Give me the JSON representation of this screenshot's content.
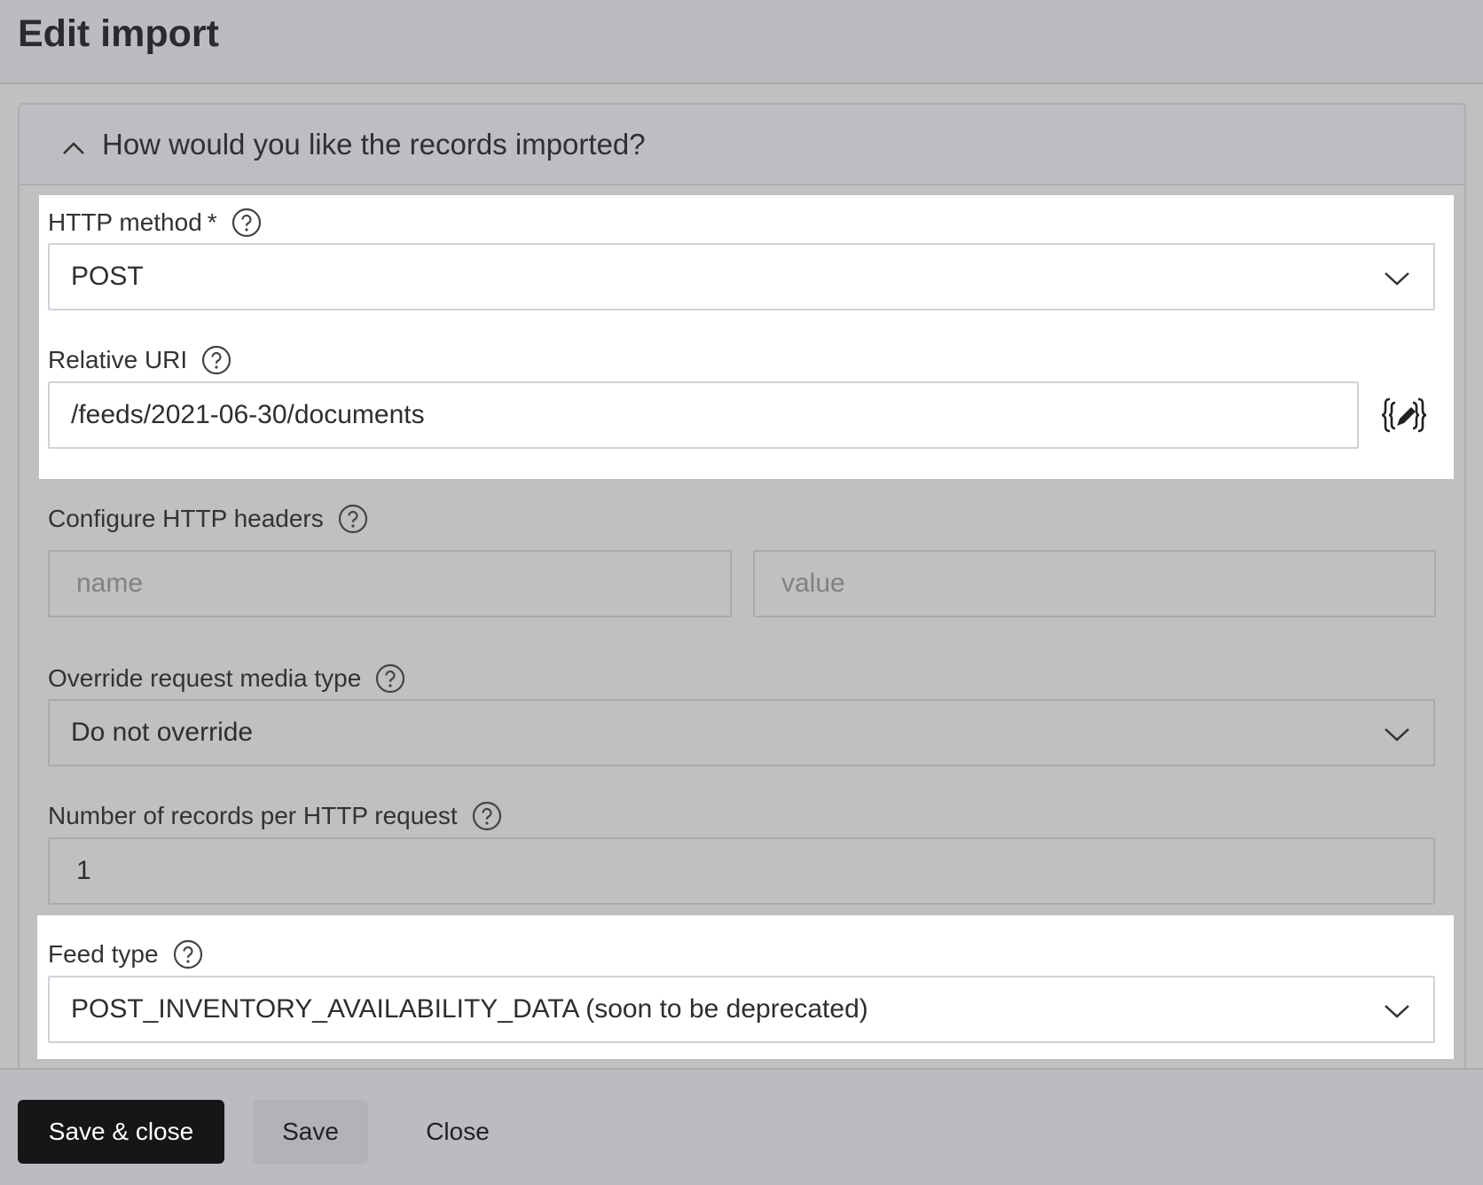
{
  "header": {
    "title": "Edit import"
  },
  "section": {
    "title": "How would you like the records imported?"
  },
  "http_method": {
    "label": "HTTP method",
    "required_marker": "*",
    "value": "POST"
  },
  "relative_uri": {
    "label": "Relative URI",
    "value": "/feeds/2021-06-30/documents"
  },
  "http_headers": {
    "label": "Configure HTTP headers",
    "name_placeholder": "name",
    "value_placeholder": "value"
  },
  "media_type": {
    "label": "Override request media type",
    "value": "Do not override"
  },
  "records_per_request": {
    "label": "Number of records per HTTP request",
    "value": "1"
  },
  "feed_type": {
    "label": "Feed type",
    "value": "POST_INVENTORY_AVAILABILITY_DATA (soon to be deprecated)"
  },
  "footer": {
    "save_close_label": "Save & close",
    "save_label": "Save",
    "close_label": "Close"
  },
  "icons": {
    "help": "help-circle-icon",
    "chevron_down": "chevron-down-icon",
    "chevron_up": "chevron-up-icon",
    "handlebars": "handlebars-editor-icon"
  }
}
